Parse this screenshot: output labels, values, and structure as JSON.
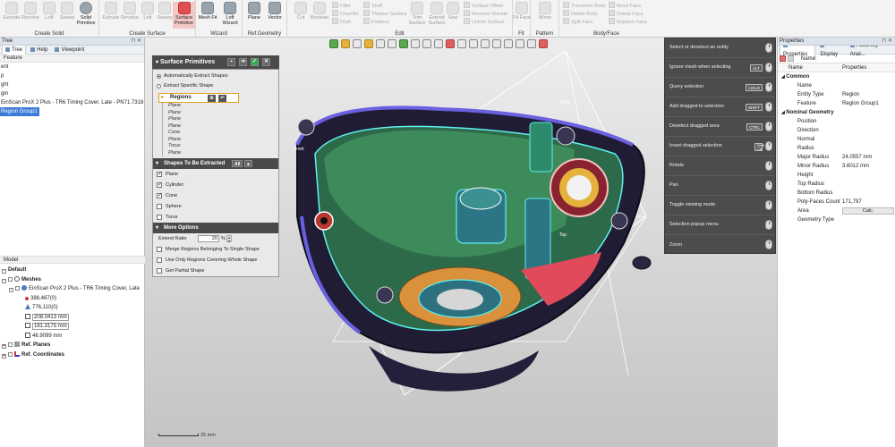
{
  "ribbon": {
    "groups": [
      {
        "title": "Create Solid",
        "items": [
          "Extrude",
          "Revolve",
          "Loft",
          "Sweep",
          "Solid Primitive"
        ]
      },
      {
        "title": "Create Surface",
        "items": [
          "Extrude",
          "Revolve",
          "Loft",
          "Sweep",
          "Surface Primitive"
        ]
      },
      {
        "title": "Wizard",
        "items": [
          "Mesh Fit",
          "Loft Wizard"
        ]
      },
      {
        "title": "Ref.Geometry",
        "items": [
          "Plane",
          "Vector"
        ]
      },
      {
        "title": "Edit",
        "items": [
          "Cut",
          "Boolean",
          "Fillet",
          "Chamfer",
          "Draft",
          "Shell",
          "Thicken Surface",
          "Emboss",
          "Trim Surface",
          "Extend Surface",
          "Sew",
          "Surface Offset",
          "Reverse Normal",
          "Untrim Surface"
        ]
      },
      {
        "title": "Fit",
        "items": [
          "Fit Face"
        ]
      },
      {
        "title": "Pattern",
        "items": [
          "Mirror"
        ]
      },
      {
        "title": "Body/Face",
        "items": [
          "Transform Body",
          "Delete Body",
          "Split Face",
          "Move Face",
          "Delete Face",
          "Replace Face"
        ]
      }
    ]
  },
  "tree_panel": {
    "title": "Tree",
    "tabs": [
      "Tree",
      "Help",
      "Viewpoint"
    ],
    "feature_header": "Feature",
    "items": [
      "ent",
      "p",
      "ght",
      "gin",
      "EinScan ProX 2 Plus - TR6 Timing Cover, Late - PN71.7318",
      "Region Group1"
    ],
    "selected_index": 5
  },
  "model_panel": {
    "title": "Model",
    "items": [
      {
        "label": "Default",
        "bold": true
      },
      {
        "label": "Meshes",
        "bold": true
      },
      {
        "label": "EinScan ProX 2 Plus - TR6 Timing Cover, Late",
        "bold": false
      },
      {
        "label": "388,467(0)",
        "bold": false
      },
      {
        "label": "776,110(0)",
        "bold": false
      },
      {
        "label": "208.0413 mm",
        "bold": false
      },
      {
        "label": "181.3175 mm",
        "bold": false
      },
      {
        "label": "46.9099 mm",
        "bold": false
      },
      {
        "label": "Ref. Planes",
        "bold": true
      },
      {
        "label": "Ref. Coordinates",
        "bold": true
      }
    ]
  },
  "surface_primitives": {
    "title": "Surface Primitives",
    "modes": [
      "Automatically Extract Shapes",
      "Extract Specific Shape"
    ],
    "regions_label": "Regions",
    "regions": [
      "Plane",
      "Plane",
      "Plane",
      "Plane",
      "Cone",
      "Plane",
      "Torus",
      "Plane"
    ],
    "shapes_header": "Shapes To Be Extracted",
    "all_label": "All",
    "shapes": [
      {
        "label": "Plane",
        "checked": true
      },
      {
        "label": "Cylinder",
        "checked": true
      },
      {
        "label": "Cone",
        "checked": true
      },
      {
        "label": "Sphere",
        "checked": false
      },
      {
        "label": "Torus",
        "checked": false
      }
    ],
    "more_header": "More Options",
    "extend_ratio_label": "Extend Ratio",
    "extend_ratio_value": "20",
    "extend_ratio_unit": "%",
    "options": [
      "Merge Regions Belonging To Single Shape",
      "Use Only Regions Covering Whole Shape",
      "Get Partial Shape"
    ]
  },
  "hints": [
    {
      "label": "Select or deselect an entity",
      "key": ""
    },
    {
      "label": "Ignore mesh when selecting",
      "key": "ALT"
    },
    {
      "label": "Query selection",
      "key": "HOLD"
    },
    {
      "label": "Add dragged to selection",
      "key": "SHIFT"
    },
    {
      "label": "Deselect dragged area",
      "key": "CTRL"
    },
    {
      "label": "Invert dragged selection",
      "key": "Shift Ctrl"
    },
    {
      "label": "Rotate",
      "key": ""
    },
    {
      "label": "Pan",
      "key": ""
    },
    {
      "label": "Toggle viewing mode",
      "key": ""
    },
    {
      "label": "Selection popup menu",
      "key": ""
    },
    {
      "label": "Zoom",
      "key": ""
    }
  ],
  "viewport_labels": {
    "right": "Right",
    "top": "Top",
    "front": "Front",
    "scale": "25 mm"
  },
  "properties": {
    "title": "Properties",
    "tabs": [
      "Properties",
      "Display",
      "Accuracy Anal..."
    ],
    "name_label": "Name:",
    "col_name": "Name",
    "col_props": "Properties",
    "rows": [
      {
        "type": "cat",
        "name": "Common",
        "value": ""
      },
      {
        "type": "row",
        "name": "Name",
        "value": ""
      },
      {
        "type": "row",
        "name": "Entity Type",
        "value": "Region"
      },
      {
        "type": "row",
        "name": "Feature",
        "value": "Region Group1"
      },
      {
        "type": "cat",
        "name": "Nominal Geometry",
        "value": ""
      },
      {
        "type": "row",
        "name": "Position",
        "value": ""
      },
      {
        "type": "row",
        "name": "Direction",
        "value": ""
      },
      {
        "type": "row",
        "name": "Normal",
        "value": ""
      },
      {
        "type": "row",
        "name": "Radius",
        "value": ""
      },
      {
        "type": "row",
        "name": "Major Radius",
        "value": "24.0557 mm"
      },
      {
        "type": "row",
        "name": "Minor Radius",
        "value": "3.6012 mm"
      },
      {
        "type": "row",
        "name": "Height",
        "value": ""
      },
      {
        "type": "row",
        "name": "Top Radius",
        "value": ""
      },
      {
        "type": "row",
        "name": "Bottom Radius",
        "value": ""
      },
      {
        "type": "row",
        "name": "Poly-Faces Count",
        "value": "171,797"
      },
      {
        "type": "row",
        "name": "Area",
        "value": "",
        "button": "Calc."
      },
      {
        "type": "row",
        "name": "Geometry Type",
        "value": ""
      }
    ]
  }
}
